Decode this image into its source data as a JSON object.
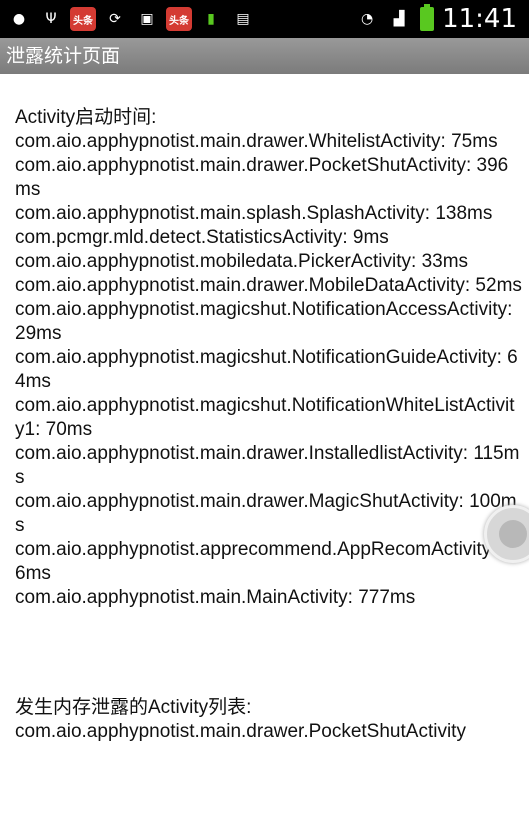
{
  "status_bar": {
    "icons": [
      "qq-icon",
      "usb-icon",
      "headline-icon",
      "sync-icon",
      "app-store-icon",
      "headline-icon",
      "battery-app-icon",
      "sim-icon"
    ],
    "badge_text": "头条",
    "time": "11:41"
  },
  "app": {
    "title": "泄露统计页面"
  },
  "content": {
    "activity_heading": "Activity启动时间:",
    "activities": [
      "com.aio.apphypnotist.main.drawer.WhitelistActivity: 75ms",
      "com.aio.apphypnotist.main.drawer.PocketShutActivity: 396ms",
      "com.aio.apphypnotist.main.splash.SplashActivity: 138ms",
      "com.pcmgr.mld.detect.StatisticsActivity: 9ms",
      "com.aio.apphypnotist.mobiledata.PickerActivity: 33ms",
      "com.aio.apphypnotist.main.drawer.MobileDataActivity: 52ms",
      "com.aio.apphypnotist.magicshut.NotificationAccessActivity: 29ms",
      "com.aio.apphypnotist.magicshut.NotificationGuideActivity: 64ms",
      "com.aio.apphypnotist.magicshut.NotificationWhiteListActivity1: 70ms",
      "com.aio.apphypnotist.main.drawer.InstalledlistActivity: 115ms",
      "com.aio.apphypnotist.main.drawer.MagicShutActivity: 100ms",
      "com.aio.apphypnotist.apprecommend.AppRecomActivity: 106ms",
      "com.aio.apphypnotist.main.MainActivity: 777ms"
    ],
    "leak_heading": "发生内存泄露的Activity列表:",
    "leaks": [
      "com.aio.apphypnotist.main.drawer.PocketShutActivity"
    ]
  }
}
